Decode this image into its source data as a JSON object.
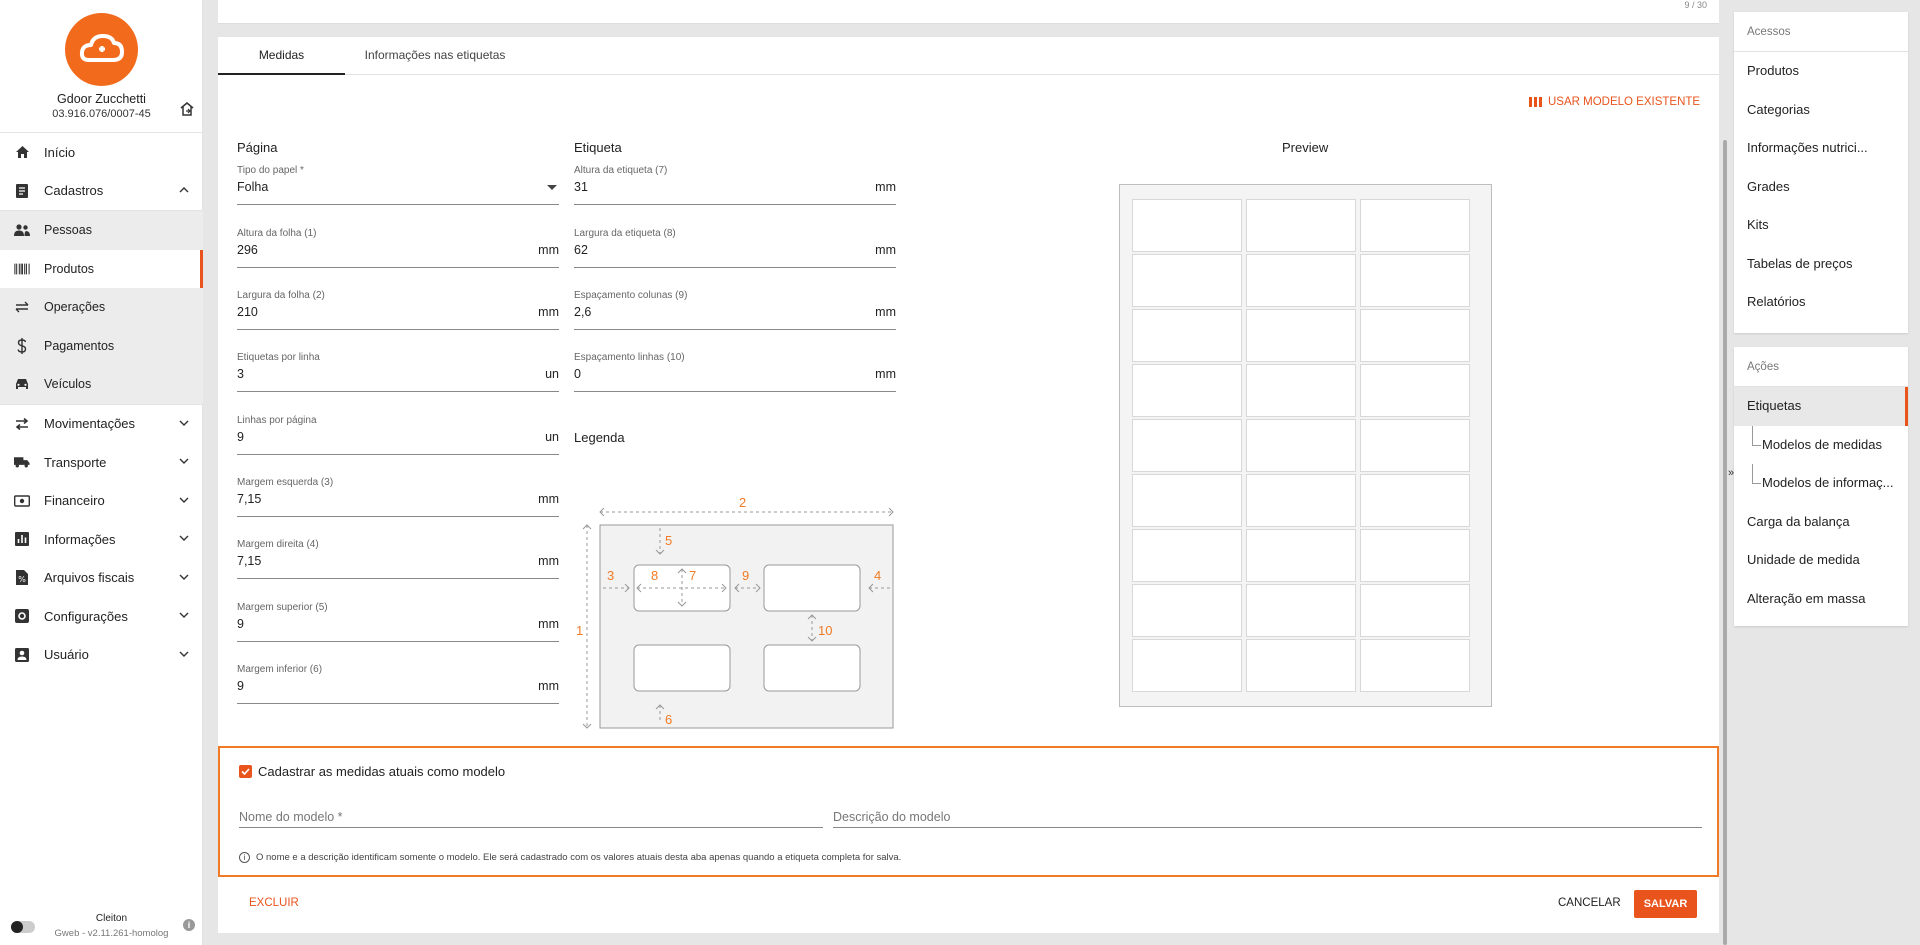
{
  "company": {
    "name": "Gdoor Zucchetti",
    "doc": "03.916.076/0007-45"
  },
  "nav": {
    "inicio": "Início",
    "cadastros": "Cadastros",
    "cadastros_items": [
      "Pessoas",
      "Produtos",
      "Operações",
      "Pagamentos",
      "Veículos"
    ],
    "movimentacoes": "Movimentações",
    "transporte": "Transporte",
    "financeiro": "Financeiro",
    "informacoes": "Informações",
    "arquivos_fiscais": "Arquivos fiscais",
    "configuracoes": "Configurações",
    "usuario": "Usuário"
  },
  "footer": {
    "user": "Cleiton",
    "version": "Gweb - v2.11.261-homolog",
    "info": "i"
  },
  "pagination": "9 / 30",
  "tabs": {
    "medidas": "Medidas",
    "informacoes": "Informações nas etiquetas"
  },
  "use_model": "USAR MODELO EXISTENTE",
  "pagina": {
    "title": "Página",
    "tipo_papel": {
      "label": "Tipo do papel *",
      "value": "Folha"
    },
    "altura_folha": {
      "label": "Altura da folha (1)",
      "value": "296",
      "unit": "mm"
    },
    "largura_folha": {
      "label": "Largura da folha (2)",
      "value": "210",
      "unit": "mm"
    },
    "etiquetas_linha": {
      "label": "Etiquetas por linha",
      "value": "3",
      "unit": "un"
    },
    "linhas_pagina": {
      "label": "Linhas por página",
      "value": "9",
      "unit": "un"
    },
    "margem_esquerda": {
      "label": "Margem esquerda (3)",
      "value": "7,15",
      "unit": "mm"
    },
    "margem_direita": {
      "label": "Margem direita (4)",
      "value": "7,15",
      "unit": "mm"
    },
    "margem_superior": {
      "label": "Margem superior (5)",
      "value": "9",
      "unit": "mm"
    },
    "margem_inferior": {
      "label": "Margem inferior (6)",
      "value": "9",
      "unit": "mm"
    }
  },
  "etiqueta": {
    "title": "Etiqueta",
    "altura": {
      "label": "Altura da etiqueta (7)",
      "value": "31",
      "unit": "mm"
    },
    "largura": {
      "label": "Largura da etiqueta (8)",
      "value": "62",
      "unit": "mm"
    },
    "esp_colunas": {
      "label": "Espaçamento colunas (9)",
      "value": "2,6",
      "unit": "mm"
    },
    "esp_linhas": {
      "label": "Espaçamento linhas (10)",
      "value": "0",
      "unit": "mm"
    }
  },
  "legenda": {
    "title": "Legenda",
    "numbers": [
      "1",
      "2",
      "3",
      "4",
      "5",
      "6",
      "7",
      "8",
      "9",
      "10"
    ]
  },
  "preview": {
    "title": "Preview",
    "columns": 3,
    "rows": 9
  },
  "model": {
    "checkbox_label": "Cadastrar as medidas atuais como modelo",
    "checked": true,
    "name_placeholder": "Nome do modelo *",
    "desc_placeholder": "Descrição do modelo",
    "hint": "O nome e a descrição identificam somente o modelo. Ele será cadastrado com os valores atuais desta aba apenas quando a etiqueta completa for salva."
  },
  "actions": {
    "delete": "EXCLUIR",
    "cancel": "CANCELAR",
    "save": "SALVAR"
  },
  "right_panel": {
    "acessos_title": "Acessos",
    "acessos": [
      "Produtos",
      "Categorias",
      "Informações nutrici...",
      "Grades",
      "Kits",
      "Tabelas de preços",
      "Relatórios"
    ],
    "acoes_title": "Ações",
    "acoes": [
      "Etiquetas",
      "Modelos de medidas",
      "Modelos de informaç...",
      "Carga da balança",
      "Unidade de medida",
      "Alteração em massa"
    ]
  },
  "colors": {
    "accent": "#e8541c",
    "highlight_border": "#f07a25"
  }
}
